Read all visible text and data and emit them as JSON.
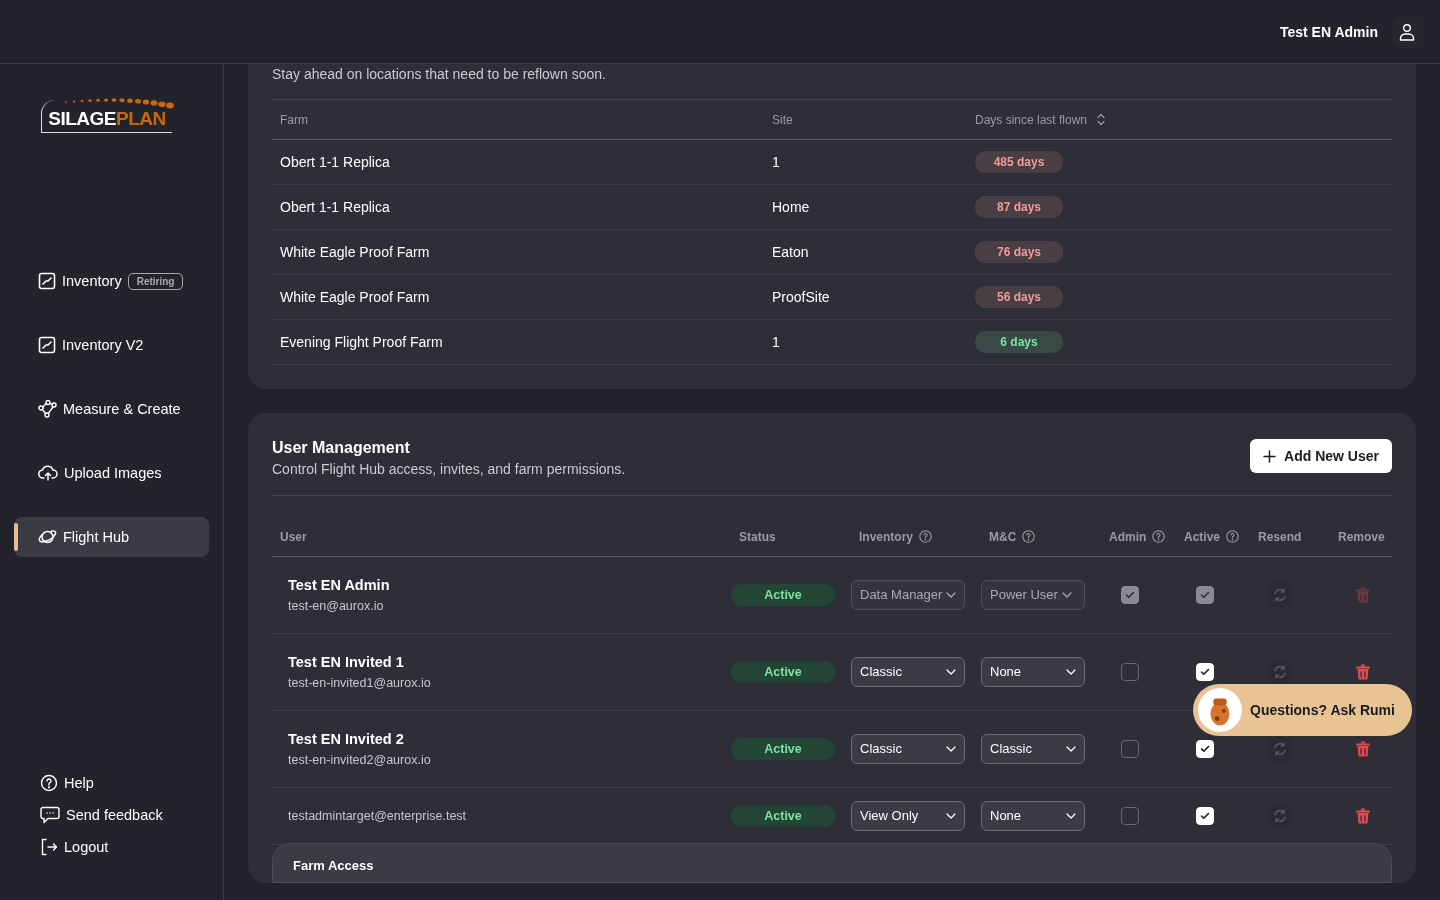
{
  "header": {
    "user_name": "Test EN Admin"
  },
  "sidebar": {
    "logo": {
      "part_1": "SILAGE",
      "part_2": "PLAN"
    },
    "items": [
      {
        "label": "Inventory",
        "badge": "Retiring",
        "selected": false
      },
      {
        "label": "Inventory V2",
        "selected": false
      },
      {
        "label": "Measure & Create",
        "selected": false
      },
      {
        "label": "Upload Images",
        "selected": false
      },
      {
        "label": "Flight Hub",
        "selected": true
      }
    ],
    "bottom_links": [
      {
        "label": "Help"
      },
      {
        "label": "Send feedback"
      },
      {
        "label": "Logout"
      }
    ]
  },
  "reflown": {
    "subtitle": "Stay ahead on locations that need to be reflown soon.",
    "columns": [
      {
        "label": "Farm"
      },
      {
        "label": "Site"
      },
      {
        "label": "Days since last flown",
        "sortable": true
      }
    ],
    "rows": [
      {
        "farm": "Obert 1-1 Replica",
        "site": "1",
        "days": "485 days",
        "color": "#f29a9a"
      },
      {
        "farm": "Obert 1-1 Replica",
        "site": "Home",
        "days": "87 days",
        "color": "#f29a9a"
      },
      {
        "farm": "White Eagle Proof Farm",
        "site": "Eaton",
        "days": "76 days",
        "color": "#f29a9a"
      },
      {
        "farm": "White Eagle Proof Farm",
        "site": "ProofSite",
        "days": "56 days",
        "color": "#f29a9a"
      },
      {
        "farm": "Evening Flight Proof Farm",
        "site": "1",
        "days": "6 days",
        "color": "#7ee2a0"
      }
    ]
  },
  "users": {
    "title": "User Management",
    "subtitle": "Control Flight Hub access, invites, and farm permissions.",
    "add_button": "Add New User",
    "columns": [
      {
        "label": "User",
        "help": false
      },
      {
        "label": "Status",
        "help": false
      },
      {
        "label": "Inventory",
        "help": true
      },
      {
        "label": "M&C",
        "help": true
      },
      {
        "label": "Admin",
        "help": true
      },
      {
        "label": "Active",
        "help": true
      },
      {
        "label": "Resend",
        "help": false
      },
      {
        "label": "Remove",
        "help": false
      }
    ],
    "rows": [
      {
        "name": "Test EN Admin",
        "email": "test-en@aurox.io",
        "status": "Active",
        "inventory": "Data Manager",
        "mc": "Power User",
        "admin": true,
        "active": true,
        "disabled": true
      },
      {
        "name": "Test EN Invited 1",
        "email": "test-en-invited1@aurox.io",
        "status": "Active",
        "inventory": "Classic",
        "mc": "None",
        "admin": false,
        "active": true,
        "disabled": false
      },
      {
        "name": "Test EN Invited 2",
        "email": "test-en-invited2@aurox.io",
        "status": "Active",
        "inventory": "Classic",
        "mc": "Classic",
        "admin": false,
        "active": true,
        "disabled": false
      },
      {
        "email": "testadmintarget@enterprise.test",
        "status": "Active",
        "inventory": "View Only",
        "mc": "None",
        "admin": false,
        "active": true,
        "disabled": false
      }
    ]
  },
  "farm_access": {
    "title": "Farm Access"
  },
  "chat_bubble": {
    "label": "Questions? Ask Rumi"
  }
}
